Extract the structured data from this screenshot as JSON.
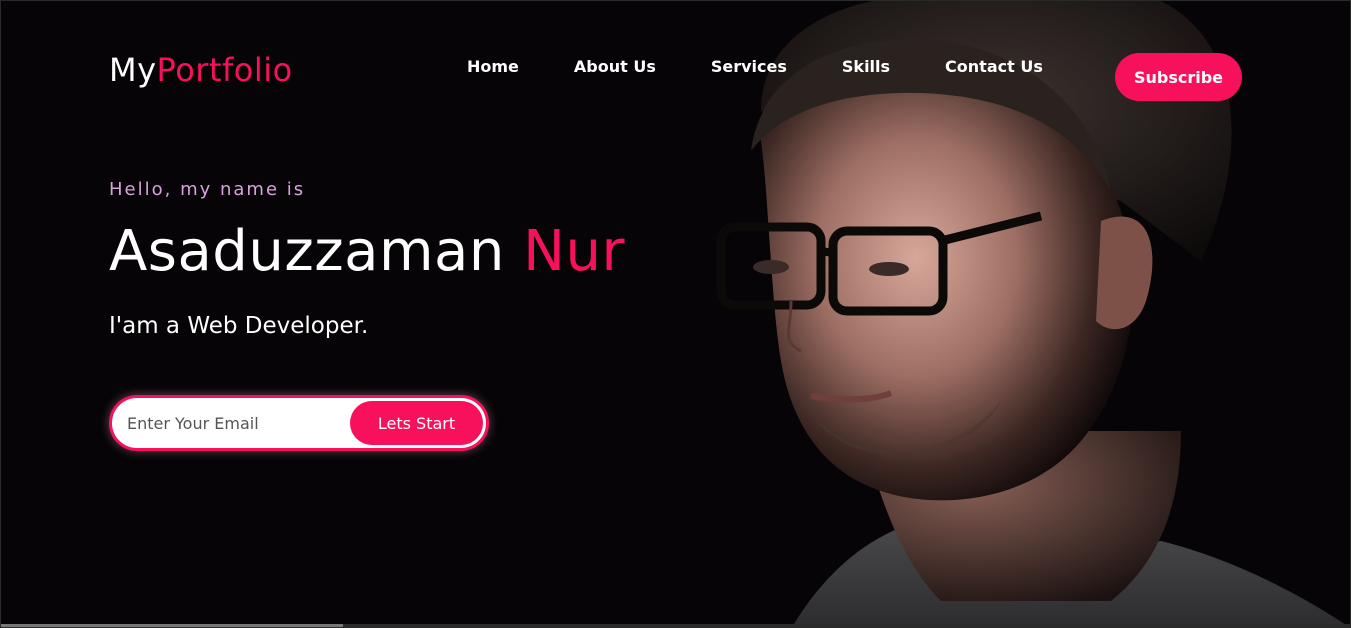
{
  "brand": {
    "first": "My",
    "second": "Portfolio",
    "accent": "#f7105c"
  },
  "nav": {
    "items": [
      {
        "label": "Home"
      },
      {
        "label": "About Us"
      },
      {
        "label": "Services"
      },
      {
        "label": "Skills"
      },
      {
        "label": "Contact Us"
      }
    ],
    "subscribe_label": "Subscribe"
  },
  "hero": {
    "greeting": "Hello, my name is",
    "first_name": "Asaduzzaman",
    "last_name": "Nur",
    "role": "I'am a Web Developer.",
    "email_placeholder": "Enter Your Email",
    "start_label": "Lets Start",
    "image_subject": "portrait of man with glasses"
  }
}
